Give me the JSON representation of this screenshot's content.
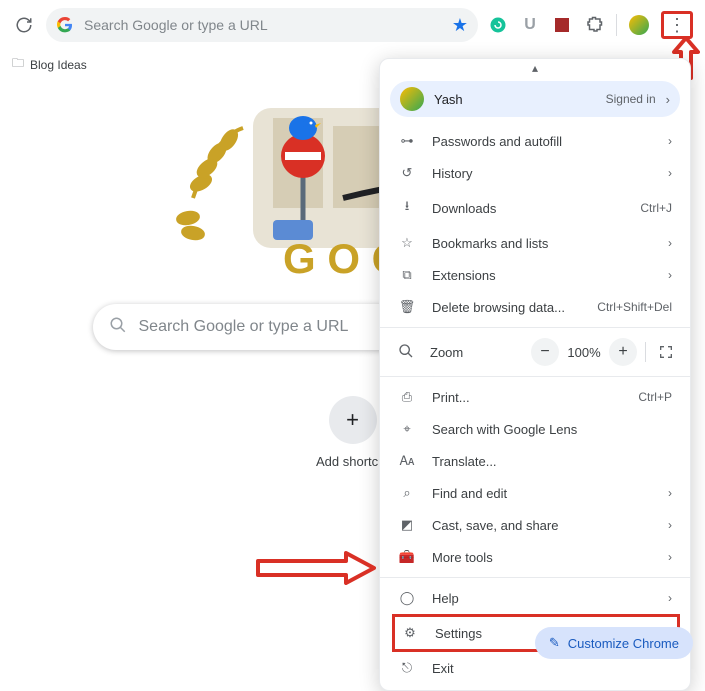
{
  "toolbar": {
    "omnibox_placeholder": "Search Google or type a URL"
  },
  "bookmarks_bar": {
    "items": [
      "Blog Ideas"
    ]
  },
  "ntp": {
    "doodle_letters": "GOOG",
    "search_placeholder": "Search Google or type a URL",
    "shortcut_label": "Add shortcut"
  },
  "menu": {
    "profile": {
      "name": "Yash",
      "status": "Signed in"
    },
    "section1": [
      {
        "icon": "key-icon",
        "glyph": "⊶",
        "label": "Passwords and autofill",
        "right": "›"
      },
      {
        "icon": "history-icon",
        "glyph": "↺",
        "label": "History",
        "right": "›"
      },
      {
        "icon": "download-icon",
        "glyph": "⭳",
        "label": "Downloads",
        "right": "Ctrl+J"
      },
      {
        "icon": "bookmark-icon",
        "glyph": "☆",
        "label": "Bookmarks and lists",
        "right": "›"
      },
      {
        "icon": "extension-icon",
        "glyph": "⧉",
        "label": "Extensions",
        "right": "›"
      },
      {
        "icon": "trash-icon",
        "glyph": "🗑",
        "label": "Delete browsing data...",
        "right": "Ctrl+Shift+Del"
      }
    ],
    "zoom": {
      "label": "Zoom",
      "value": "100%"
    },
    "section2": [
      {
        "icon": "print-icon",
        "glyph": "⎙",
        "label": "Print...",
        "right": "Ctrl+P"
      },
      {
        "icon": "lens-icon",
        "glyph": "⌖",
        "label": "Search with Google Lens",
        "right": ""
      },
      {
        "icon": "translate-icon",
        "glyph": "🗛",
        "label": "Translate...",
        "right": ""
      },
      {
        "icon": "find-icon",
        "glyph": "⌕",
        "label": "Find and edit",
        "right": "›"
      },
      {
        "icon": "cast-icon",
        "glyph": "◩",
        "label": "Cast, save, and share",
        "right": "›"
      },
      {
        "icon": "tools-icon",
        "glyph": "🧰",
        "label": "More tools",
        "right": "›"
      }
    ],
    "section3": [
      {
        "icon": "help-icon",
        "glyph": "◯",
        "label": "Help",
        "right": "›"
      }
    ],
    "settings": {
      "icon": "gear-icon",
      "glyph": "⚙",
      "label": "Settings"
    },
    "exit": {
      "icon": "exit-icon",
      "glyph": "⎋",
      "label": "Exit"
    }
  },
  "customize_label": "Customize Chrome",
  "annotations": {
    "highlights": [
      "kebab-menu-button",
      "settings-menu-item"
    ]
  }
}
